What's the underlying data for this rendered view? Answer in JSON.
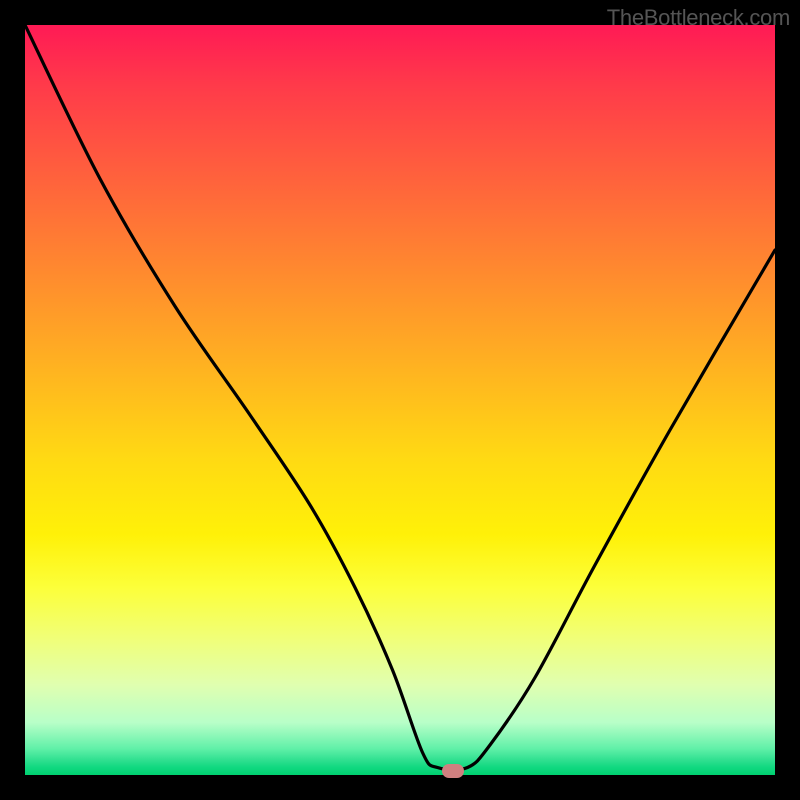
{
  "watermark": "TheBottleneck.com",
  "chart_data": {
    "type": "line",
    "title": "",
    "xlabel": "",
    "ylabel": "",
    "xlim": [
      0,
      100
    ],
    "ylim": [
      0,
      100
    ],
    "series": [
      {
        "name": "bottleneck-curve",
        "x": [
          0,
          10,
          20,
          30,
          38,
          44,
          49,
          53,
          55,
          59,
          62,
          68,
          76,
          86,
          100
        ],
        "values": [
          100,
          79.5,
          62.5,
          48,
          36,
          25,
          14,
          3,
          1,
          1,
          4,
          13,
          28,
          46,
          70
        ]
      }
    ],
    "marker": {
      "x": 57,
      "y": 0.5,
      "color": "#d08080"
    },
    "background_gradient": {
      "top": "#ff1a55",
      "mid": "#ffda13",
      "bottom": "#00d070"
    },
    "grid": false,
    "legend": false
  }
}
